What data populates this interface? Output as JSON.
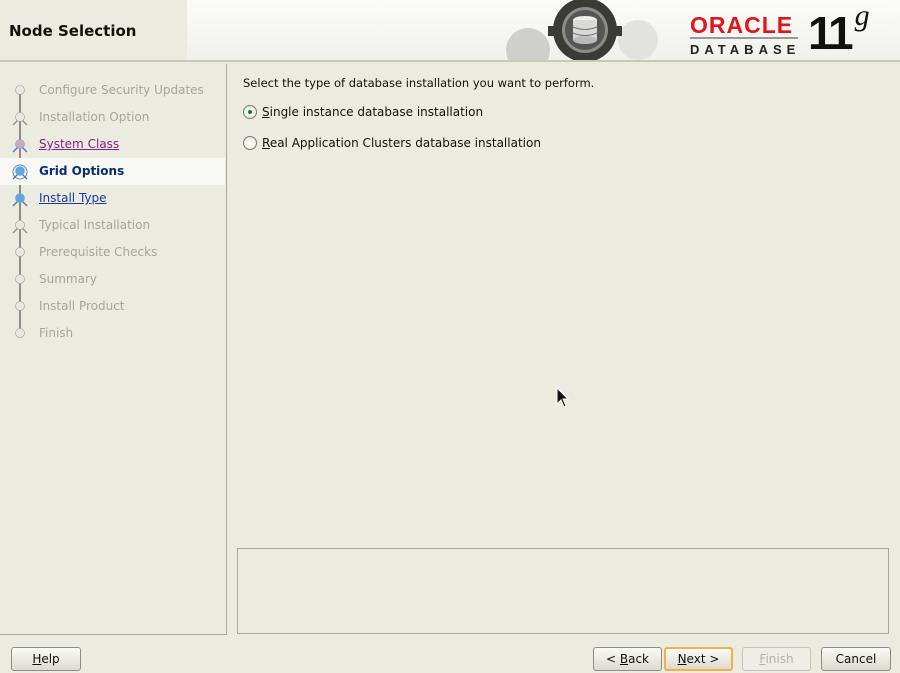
{
  "header": {
    "title": "Node Selection",
    "logo_oracle": "ORACLE",
    "logo_database": "DATABASE",
    "logo_version": "11",
    "logo_version_suffix": "g"
  },
  "sidebar": {
    "steps": [
      {
        "label": "Configure Security Updates",
        "state": "disabled"
      },
      {
        "label": "Installation Option",
        "state": "disabled"
      },
      {
        "label": "System Class",
        "state": "visited"
      },
      {
        "label": "Grid Options",
        "state": "current"
      },
      {
        "label": "Install Type",
        "state": "link"
      },
      {
        "label": "Typical Installation",
        "state": "disabled"
      },
      {
        "label": "Prerequisite Checks",
        "state": "disabled"
      },
      {
        "label": "Summary",
        "state": "disabled"
      },
      {
        "label": "Install Product",
        "state": "disabled"
      },
      {
        "label": "Finish",
        "state": "disabled"
      }
    ]
  },
  "main": {
    "prompt": "Select the type of database installation you want to perform.",
    "options": [
      {
        "label": "Single instance database installation",
        "selected": true
      },
      {
        "label": "Real Application Clusters database installation",
        "selected": false
      }
    ]
  },
  "buttons": {
    "help": "Help",
    "back_prefix": "<",
    "back": "Back",
    "next": "Next",
    "next_suffix": ">",
    "finish": "Finish",
    "cancel": "Cancel"
  },
  "colors": {
    "accent_red": "#e0161c",
    "current_step": "#0b2a7a",
    "visited_step": "#8a1d8a"
  }
}
